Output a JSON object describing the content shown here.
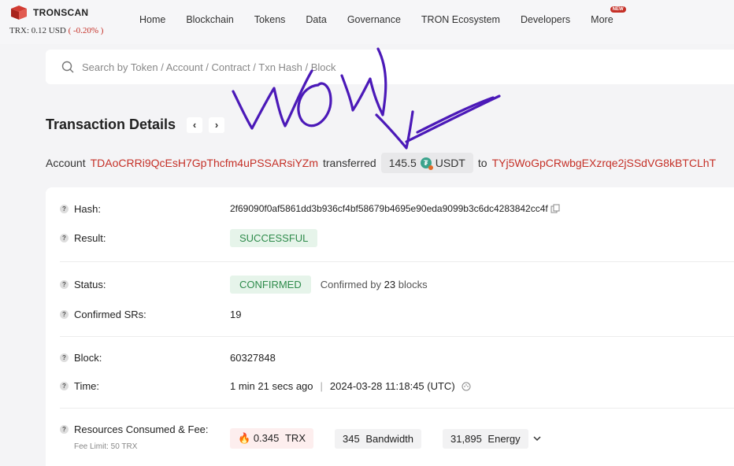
{
  "header": {
    "brand": "TRONSCAN",
    "price_label": "TRX: 0.12 USD",
    "price_change": "( -0.20% )",
    "nav": [
      "Home",
      "Blockchain",
      "Tokens",
      "Data",
      "Governance",
      "TRON Ecosystem",
      "Developers",
      "More"
    ],
    "new_badge": "NEW"
  },
  "search": {
    "placeholder": "Search by Token / Account / Contract / Txn Hash / Block"
  },
  "annotation": {
    "handwritten_text": "WoW"
  },
  "page": {
    "title": "Transaction Details",
    "prev": "‹",
    "next": "›"
  },
  "summary": {
    "prefix": "Account",
    "from": "TDAoCRRi9QcEsH7GpThcfm4uPSSARsiYZm",
    "verb": "transferred",
    "amount": "145.5",
    "token": "USDT",
    "to_word": "to",
    "to": "TYj5WoGpCRwbgEXzrqe2jSSdVG8kBTCLhT"
  },
  "details": {
    "hash_label": "Hash:",
    "hash": "2f69090f0af5861dd3b936cf4bf58679b4695e90eda9099b3c6dc4283842cc4f",
    "result_label": "Result:",
    "result": "SUCCESSFUL",
    "status_label": "Status:",
    "status": "CONFIRMED",
    "confirmed_by_prefix": "Confirmed by",
    "confirmed_blocks": "23",
    "confirmed_by_suffix": "blocks",
    "srs_label": "Confirmed SRs:",
    "srs": "19",
    "block_label": "Block:",
    "block": "60327848",
    "time_label": "Time:",
    "time_ago": "1 min 21 secs ago",
    "time_full": "2024-03-28 11:18:45 (UTC)",
    "resources_label": "Resources Consumed & Fee:",
    "fee_limit": "Fee Limit: 50 TRX",
    "trx_amount": "0.345",
    "trx_unit": "TRX",
    "bandwidth_amount": "345",
    "bandwidth_unit": "Bandwidth",
    "energy_amount": "31,895",
    "energy_unit": "Energy"
  },
  "colors": {
    "accent": "#c53027",
    "success": "#2e8b4b",
    "ink": "#4b19b8"
  }
}
